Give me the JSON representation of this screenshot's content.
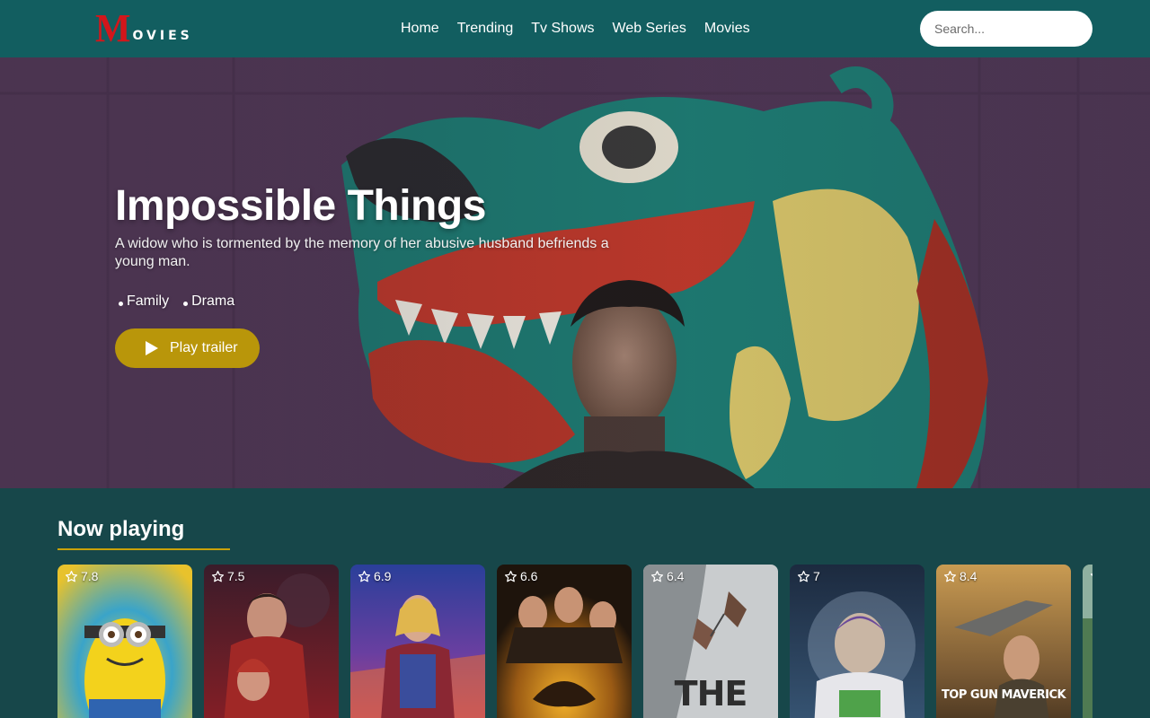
{
  "header": {
    "logo_initial": "M",
    "logo_rest": "OVIES",
    "nav": [
      "Home",
      "Trending",
      "Tv Shows",
      "Web Series",
      "Movies"
    ],
    "search_placeholder": "Search..."
  },
  "hero": {
    "title": "Impossible Things",
    "description": "A widow who is tormented by the memory of her abusive husband befriends a young man.",
    "genres": [
      "Family",
      "Drama"
    ],
    "play_label": "Play trailer",
    "play_icon": "play-icon"
  },
  "now_playing": {
    "title": "Now playing",
    "movies": [
      {
        "rating": "7.8",
        "poster": "minions-poster"
      },
      {
        "rating": "7.5",
        "poster": "doctor-strange-poster"
      },
      {
        "rating": "6.9",
        "poster": "thor-poster"
      },
      {
        "rating": "6.6",
        "poster": "jurassic-world-poster"
      },
      {
        "rating": "6.4",
        "poster": "the-ledge-poster",
        "poster_text": "THE LEDGE"
      },
      {
        "rating": "7",
        "poster": "lightyear-poster"
      },
      {
        "rating": "8.4",
        "poster": "top-gun-poster",
        "poster_text": "TOP GUN MAVERICK"
      }
    ]
  },
  "colors": {
    "header_bg": "#125e60",
    "page_bg": "#17474a",
    "accent": "#b9960a",
    "logo_red": "#d2161b"
  }
}
